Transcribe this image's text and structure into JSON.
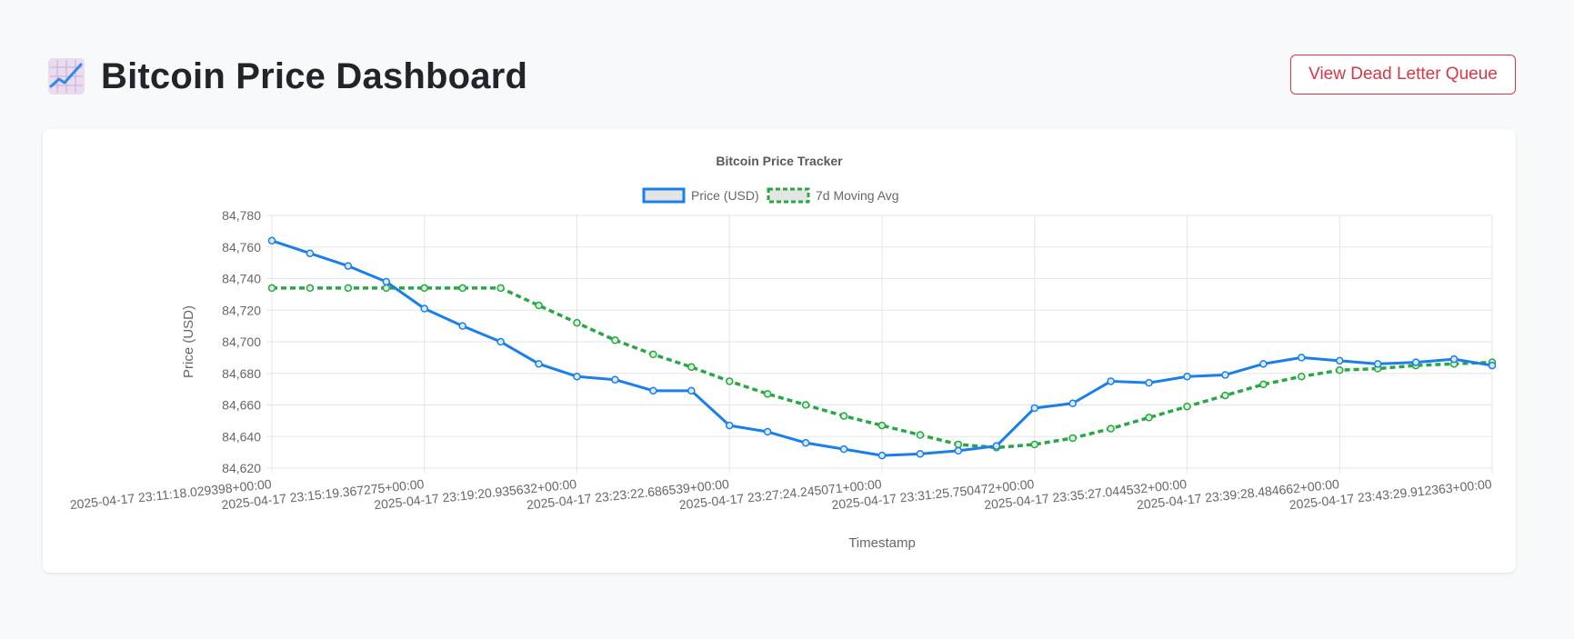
{
  "header": {
    "title": "Bitcoin Price Dashboard",
    "icon": "chart-increasing-icon",
    "dlq_button_label": "View Dead Letter Queue"
  },
  "colors": {
    "price_line": "#1a7fe8",
    "moving_avg_line": "#28a745",
    "danger": "#dc3545",
    "grid": "#e5e5e5"
  },
  "chart_data": {
    "type": "line",
    "title": "Bitcoin Price Tracker",
    "xlabel": "Timestamp",
    "ylabel": "Price (USD)",
    "ylim": [
      84620,
      84780
    ],
    "y_ticks": [
      "84,620",
      "84,640",
      "84,660",
      "84,680",
      "84,700",
      "84,720",
      "84,740",
      "84,760",
      "84,780"
    ],
    "x_tick_labels": [
      "2025-04-17 23:11:18.029398+00:00",
      "2025-04-17 23:15:19.367275+00:00",
      "2025-04-17 23:19:20.935632+00:00",
      "2025-04-17 23:23:22.686539+00:00",
      "2025-04-17 23:27:24.245071+00:00",
      "2025-04-17 23:31:25.750472+00:00",
      "2025-04-17 23:35:27.044532+00:00",
      "2025-04-17 23:39:28.484662+00:00",
      "2025-04-17 23:43:29.912363+00:00"
    ],
    "point_count": 33,
    "grid": true,
    "legend_position": "top",
    "series": [
      {
        "name": "Price (USD)",
        "style": "solid",
        "values": [
          84764,
          84756,
          84748,
          84738,
          84721,
          84710,
          84700,
          84686,
          84678,
          84676,
          84669,
          84669,
          84647,
          84643,
          84636,
          84632,
          84628,
          84629,
          84631,
          84634,
          84658,
          84661,
          84675,
          84674,
          84678,
          84679,
          84686,
          84690,
          84688,
          84686,
          84687,
          84689,
          84685
        ]
      },
      {
        "name": "7d Moving Avg",
        "style": "dashed",
        "values": [
          84734,
          84734,
          84734,
          84734,
          84734,
          84734,
          84734,
          84723,
          84712,
          84701,
          84692,
          84684,
          84675,
          84667,
          84660,
          84653,
          84647,
          84641,
          84635,
          84633,
          84635,
          84639,
          84645,
          84652,
          84659,
          84666,
          84673,
          84678,
          84682,
          84683,
          84685,
          84686,
          84687
        ]
      }
    ]
  }
}
